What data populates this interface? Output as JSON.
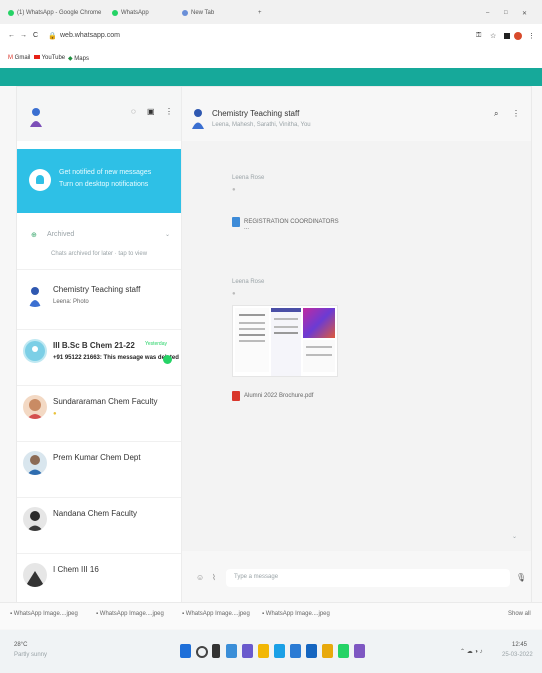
{
  "browser": {
    "tabs": [
      "(1) WhatsApp - Google Chrome",
      "WhatsApp",
      "New Tab"
    ],
    "address": "web.whatsapp.com",
    "bookmarks": [
      "Gmail",
      "YouTube",
      "Maps"
    ]
  },
  "sidebar": {
    "notification": {
      "line1": "Get notified of new messages",
      "line2": "Turn on desktop notifications"
    },
    "archived": {
      "label": "Archived",
      "sub": "Chats archived for later · tap to view"
    },
    "chats": [
      {
        "name": "Chemistry Teaching staff",
        "sub": "Leena: Photo",
        "time": ""
      },
      {
        "name": "III B.Sc B Chem 21-22",
        "sub": "+91 95122 21663: This message was deleted",
        "time": "Yesterday",
        "unread": "1"
      },
      {
        "name": "Sundararaman Chem Faculty",
        "sub": "●",
        "time": ""
      },
      {
        "name": "Prem Kumar Chem Dept",
        "sub": "",
        "time": ""
      },
      {
        "name": "Nandana Chem Faculty",
        "sub": "",
        "time": ""
      },
      {
        "name": "I Chem III 16",
        "sub": "",
        "time": ""
      }
    ]
  },
  "conversation": {
    "title": "Chemistry Teaching staff",
    "subtitle": "Leena, Mahesh, Sarathi, Vinitha, You",
    "msg1": {
      "sender": "Leena Rose",
      "file": "REGISTRATION COORDINATORS ..."
    },
    "msg2": {
      "sender": "Leena Rose",
      "file": "Alumni 2022 Brochure.pdf"
    },
    "composer_placeholder": "Type a message"
  },
  "downloads": [
    "WhatsApp Image....jpeg",
    "WhatsApp Image....jpeg",
    "WhatsApp Image....jpeg",
    "WhatsApp Image....jpeg"
  ],
  "downloads_show_all": "Show all",
  "taskbar": {
    "weather": "28°C",
    "weather_sub": "Partly sunny",
    "time": "12:45",
    "date": "25-03-2022"
  },
  "colors": {
    "teal": "#16a99a",
    "notif_blue": "#2ec0e6",
    "green": "#25d366"
  }
}
